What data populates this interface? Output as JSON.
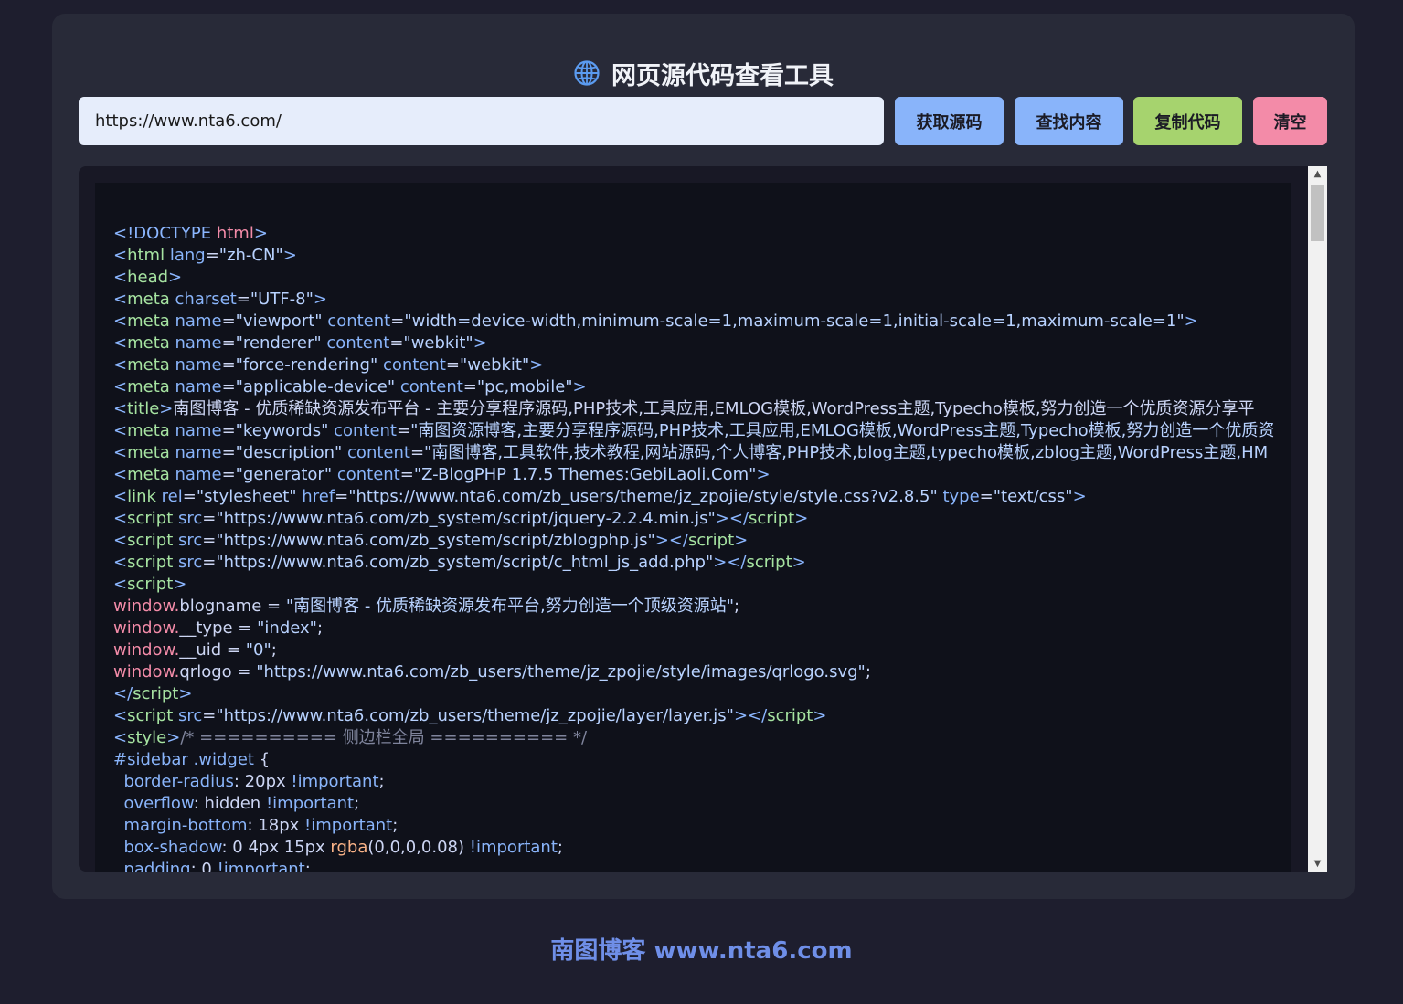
{
  "header": {
    "icon": "globe-icon",
    "title": "网页源代码查看工具"
  },
  "toolbar": {
    "url_value": "https://www.nta6.com/",
    "fetch_label": "获取源码",
    "find_label": "查找内容",
    "copy_label": "复制代码",
    "clear_label": "清空"
  },
  "code_view": {
    "lines": [
      [
        [
          "br",
          "<!DOCTYPE "
        ],
        [
          "kw",
          "html"
        ],
        [
          "br",
          ">"
        ]
      ],
      [
        [
          "br",
          "<"
        ],
        [
          "tg",
          "html "
        ],
        [
          "at",
          "lang"
        ],
        [
          "pl",
          "="
        ],
        [
          "vl",
          "\"zh-CN\""
        ],
        [
          "br",
          ">"
        ]
      ],
      [
        [
          "br",
          "<"
        ],
        [
          "tg",
          "head"
        ],
        [
          "br",
          ">"
        ]
      ],
      [
        [
          "br",
          "<"
        ],
        [
          "tg",
          "meta "
        ],
        [
          "at",
          "charset"
        ],
        [
          "pl",
          "="
        ],
        [
          "vl",
          "\"UTF-8\""
        ],
        [
          "br",
          ">"
        ]
      ],
      [
        [
          "br",
          "<"
        ],
        [
          "tg",
          "meta "
        ],
        [
          "at",
          "name"
        ],
        [
          "pl",
          "="
        ],
        [
          "vl",
          "\"viewport\" "
        ],
        [
          "at",
          "content"
        ],
        [
          "pl",
          "="
        ],
        [
          "vl",
          "\"width=device-width,minimum-scale=1,maximum-scale=1,initial-scale=1,maximum-scale=1\""
        ],
        [
          "br",
          ">"
        ]
      ],
      [
        [
          "br",
          "<"
        ],
        [
          "tg",
          "meta "
        ],
        [
          "at",
          "name"
        ],
        [
          "pl",
          "="
        ],
        [
          "vl",
          "\"renderer\" "
        ],
        [
          "at",
          "content"
        ],
        [
          "pl",
          "="
        ],
        [
          "vl",
          "\"webkit\""
        ],
        [
          "br",
          ">"
        ]
      ],
      [
        [
          "br",
          "<"
        ],
        [
          "tg",
          "meta "
        ],
        [
          "at",
          "name"
        ],
        [
          "pl",
          "="
        ],
        [
          "vl",
          "\"force-rendering\" "
        ],
        [
          "at",
          "content"
        ],
        [
          "pl",
          "="
        ],
        [
          "vl",
          "\"webkit\""
        ],
        [
          "br",
          ">"
        ]
      ],
      [
        [
          "br",
          "<"
        ],
        [
          "tg",
          "meta "
        ],
        [
          "at",
          "name"
        ],
        [
          "pl",
          "="
        ],
        [
          "vl",
          "\"applicable-device\" "
        ],
        [
          "at",
          "content"
        ],
        [
          "pl",
          "="
        ],
        [
          "vl",
          "\"pc,mobile\""
        ],
        [
          "br",
          ">"
        ]
      ],
      [
        [
          "br",
          "<"
        ],
        [
          "tg",
          "title"
        ],
        [
          "br",
          ">"
        ],
        [
          "tx",
          "南图博客 - 优质稀缺资源发布平台 - 主要分享程序源码,PHP技术,工具应用,EMLOG模板,WordPress主题,Typecho模板,努力创造一个优质资源分享平"
        ]
      ],
      [
        [
          "br",
          "<"
        ],
        [
          "tg",
          "meta "
        ],
        [
          "at",
          "name"
        ],
        [
          "pl",
          "="
        ],
        [
          "vl",
          "\"keywords\" "
        ],
        [
          "at",
          "content"
        ],
        [
          "pl",
          "="
        ],
        [
          "vl",
          "\"南图资源博客,主要分享程序源码,PHP技术,工具应用,EMLOG模板,WordPress主题,Typecho模板,努力创造一个优质资"
        ]
      ],
      [
        [
          "br",
          "<"
        ],
        [
          "tg",
          "meta "
        ],
        [
          "at",
          "name"
        ],
        [
          "pl",
          "="
        ],
        [
          "vl",
          "\"description\" "
        ],
        [
          "at",
          "content"
        ],
        [
          "pl",
          "="
        ],
        [
          "vl",
          "\"南图博客,工具软件,技术教程,网站源码,个人博客,PHP技术,blog主题,typecho模板,zblog主题,WordPress主题,HM"
        ]
      ],
      [
        [
          "br",
          "<"
        ],
        [
          "tg",
          "meta "
        ],
        [
          "at",
          "name"
        ],
        [
          "pl",
          "="
        ],
        [
          "vl",
          "\"generator\" "
        ],
        [
          "at",
          "content"
        ],
        [
          "pl",
          "="
        ],
        [
          "vl",
          "\"Z-BlogPHP 1.7.5 Themes:GebiLaoli.Com\""
        ],
        [
          "br",
          ">"
        ]
      ],
      [
        [
          "br",
          "<"
        ],
        [
          "tg",
          "link "
        ],
        [
          "at",
          "rel"
        ],
        [
          "pl",
          "="
        ],
        [
          "vl",
          "\"stylesheet\" "
        ],
        [
          "at",
          "href"
        ],
        [
          "pl",
          "="
        ],
        [
          "vl",
          "\"https://www.nta6.com/zb_users/theme/jz_zpojie/style/style.css?v2.8.5\" "
        ],
        [
          "at",
          "type"
        ],
        [
          "pl",
          "="
        ],
        [
          "vl",
          "\"text/css\""
        ],
        [
          "br",
          ">"
        ]
      ],
      [
        [
          "br",
          "<"
        ],
        [
          "tg",
          "script "
        ],
        [
          "at",
          "src"
        ],
        [
          "pl",
          "="
        ],
        [
          "vl",
          "\"https://www.nta6.com/zb_system/script/jquery-2.2.4.min.js\""
        ],
        [
          "br",
          "></"
        ],
        [
          "tg",
          "script"
        ],
        [
          "br",
          ">"
        ]
      ],
      [
        [
          "br",
          "<"
        ],
        [
          "tg",
          "script "
        ],
        [
          "at",
          "src"
        ],
        [
          "pl",
          "="
        ],
        [
          "vl",
          "\"https://www.nta6.com/zb_system/script/zblogphp.js\""
        ],
        [
          "br",
          "></"
        ],
        [
          "tg",
          "script"
        ],
        [
          "br",
          ">"
        ]
      ],
      [
        [
          "br",
          "<"
        ],
        [
          "tg",
          "script "
        ],
        [
          "at",
          "src"
        ],
        [
          "pl",
          "="
        ],
        [
          "vl",
          "\"https://www.nta6.com/zb_system/script/c_html_js_add.php\""
        ],
        [
          "br",
          "></"
        ],
        [
          "tg",
          "script"
        ],
        [
          "br",
          ">"
        ]
      ],
      [
        [
          "br",
          "<"
        ],
        [
          "tg",
          "script"
        ],
        [
          "br",
          ">"
        ]
      ],
      [
        [
          "kw",
          "window."
        ],
        [
          "tx",
          "blogname = "
        ],
        [
          "vl",
          "\"南图博客 - 优质稀缺资源发布平台,努力创造一个顶级资源站\""
        ],
        [
          "tx",
          ";"
        ]
      ],
      [
        [
          "kw",
          "window."
        ],
        [
          "tx",
          "__type = "
        ],
        [
          "vl",
          "\"index\""
        ],
        [
          "tx",
          ";"
        ]
      ],
      [
        [
          "kw",
          "window."
        ],
        [
          "tx",
          "__uid = "
        ],
        [
          "vl",
          "\"0\""
        ],
        [
          "tx",
          ";"
        ]
      ],
      [
        [
          "kw",
          "window."
        ],
        [
          "tx",
          "qrlogo = "
        ],
        [
          "vl",
          "\"https://www.nta6.com/zb_users/theme/jz_zpojie/style/images/qrlogo.svg\""
        ],
        [
          "tx",
          ";"
        ]
      ],
      [
        [
          "br",
          "</"
        ],
        [
          "tg",
          "script"
        ],
        [
          "br",
          ">"
        ]
      ],
      [
        [
          "br",
          "<"
        ],
        [
          "tg",
          "script "
        ],
        [
          "at",
          "src"
        ],
        [
          "pl",
          "="
        ],
        [
          "vl",
          "\"https://www.nta6.com/zb_users/theme/jz_zpojie/layer/layer.js\""
        ],
        [
          "br",
          "></"
        ],
        [
          "tg",
          "script"
        ],
        [
          "br",
          ">"
        ]
      ],
      [
        [
          "br",
          "<"
        ],
        [
          "tg",
          "style"
        ],
        [
          "br",
          ">"
        ],
        [
          "cm",
          "/* ========== 侧边栏全局 ========== */"
        ]
      ],
      [
        [
          "at",
          "#sidebar .widget"
        ],
        [
          "tx",
          " {"
        ]
      ],
      [
        [
          "tx",
          "  "
        ],
        [
          "at",
          "border-radius"
        ],
        [
          "tx",
          ": 20px "
        ],
        [
          "at",
          "!important"
        ],
        [
          "tx",
          ";"
        ]
      ],
      [
        [
          "tx",
          "  "
        ],
        [
          "at",
          "overflow"
        ],
        [
          "tx",
          ": hidden "
        ],
        [
          "at",
          "!important"
        ],
        [
          "tx",
          ";"
        ]
      ],
      [
        [
          "tx",
          "  "
        ],
        [
          "at",
          "margin-bottom"
        ],
        [
          "tx",
          ": 18px "
        ],
        [
          "at",
          "!important"
        ],
        [
          "tx",
          ";"
        ]
      ],
      [
        [
          "tx",
          "  "
        ],
        [
          "at",
          "box-shadow"
        ],
        [
          "tx",
          ": 0 4px 15px "
        ],
        [
          "fn",
          "rgba"
        ],
        [
          "tx",
          "(0,0,0,0.08) "
        ],
        [
          "at",
          "!important"
        ],
        [
          "tx",
          ";"
        ]
      ],
      [
        [
          "tx",
          "  "
        ],
        [
          "at",
          "padding"
        ],
        [
          "tx",
          ": 0 "
        ],
        [
          "at",
          "!important"
        ],
        [
          "tx",
          ";"
        ]
      ]
    ]
  },
  "footer": {
    "text": "南图博客 www.nta6.com"
  }
}
